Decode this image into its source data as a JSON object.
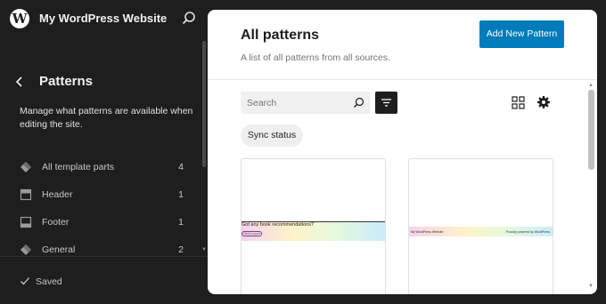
{
  "site": {
    "title": "My WordPress Website",
    "logo_letter": "W"
  },
  "sidebar": {
    "heading": "Patterns",
    "description": "Manage what patterns are available when editing the site.",
    "items": [
      {
        "label": "All template parts",
        "count": "4",
        "icon": "symbol-icon"
      },
      {
        "label": "Header",
        "count": "1",
        "icon": "header-icon"
      },
      {
        "label": "Footer",
        "count": "1",
        "icon": "footer-icon"
      },
      {
        "label": "General",
        "count": "2",
        "icon": "symbol-icon"
      }
    ],
    "status": "Saved"
  },
  "main": {
    "title": "All patterns",
    "subtitle": "A list of all patterns from all sources.",
    "add_button": "Add New Pattern",
    "search_placeholder": "Search",
    "filter_chip": "Sync status",
    "cards": [
      {
        "preview_text": "Got any book recommendations?",
        "preview_button": "Get in touch"
      },
      {
        "preview_site": "My WordPress Website",
        "preview_credit": "Proudly powered by WordPress"
      }
    ]
  },
  "colors": {
    "accent": "#007cba",
    "sidebar_bg": "#1e1e1e",
    "panel_bg": "#ffffff"
  }
}
